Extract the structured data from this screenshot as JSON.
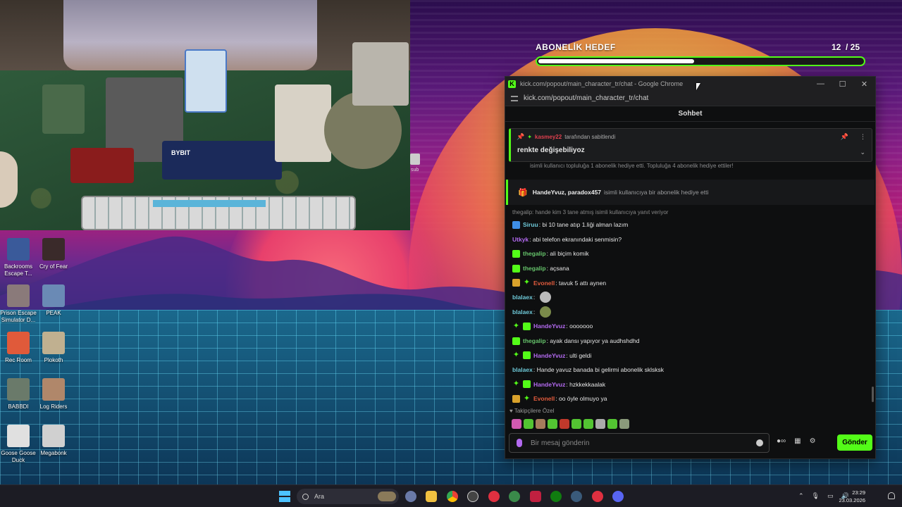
{
  "goal": {
    "title": "ABONELİK HEDEF",
    "current": 12,
    "separator": "/",
    "target": 25,
    "current_text": "12",
    "target_text": "/ 25",
    "progress_fraction": 0.48
  },
  "window": {
    "title": "kick.com/popout/main_character_tr/chat - Google Chrome",
    "url": "kick.com/popout/main_character_tr/chat",
    "minimize": "—",
    "maximize": "☐",
    "close": "✕"
  },
  "chat": {
    "header": "Sohbet",
    "pinned": {
      "by_user": "kasmey22",
      "by_suffix": "tarafından sabitlendi",
      "message": "renkte değişebiliyoz"
    },
    "gift_clip_text": "isimli kullanıcı topluluğa 1 abonelik hediye etti. Topluluğa 4 abonelik hediye ettiler!",
    "gift_card": {
      "names": "HandeYvuz, paradox457",
      "text": "isimli kullanıcıya bir abonelik hediye etti"
    },
    "reply_line": "thegalip: hande kim 3 tane atmış isimli kullanıcıya yanıt veriyor",
    "messages": [
      {
        "user": "Siruu",
        "text": "bi 10 tane atıp 1.liği alman lazım",
        "color": "u-teal",
        "badges": [
          "verified"
        ]
      },
      {
        "user": "Utkyk",
        "text": "abi telefon ekranındaki senmisin?",
        "color": "u-purple",
        "badges": []
      },
      {
        "user": "thegalip",
        "text": "ali biçim komik",
        "color": "u-green",
        "badges": [
          "sub"
        ]
      },
      {
        "user": "thegalip",
        "text": "açsana",
        "color": "u-green",
        "badges": [
          "sub"
        ]
      },
      {
        "user": "Evonell",
        "text": "tavuk 5 attı aynen",
        "color": "u-red",
        "badges": [
          "crown",
          "spark"
        ]
      },
      {
        "user": "blalaex",
        "text": "",
        "color": "u-teal",
        "badges": [],
        "emote": "#bbbbbb"
      },
      {
        "user": "blalaex",
        "text": "",
        "color": "u-teal",
        "badges": [],
        "emote": "#7a8a4a"
      },
      {
        "user": "HandeYvuz",
        "text": "ooooooo",
        "color": "u-purple",
        "badges": [
          "spark",
          "sub"
        ]
      },
      {
        "user": "thegalip",
        "text": "ayak dansı yapıyor ya audhshdhd",
        "color": "u-green",
        "badges": [
          "sub"
        ]
      },
      {
        "user": "HandeYvuz",
        "text": "ulti geldi",
        "color": "u-purple",
        "badges": [
          "spark",
          "sub"
        ]
      },
      {
        "user": "blalaex",
        "text": "Hande yavuz banada bi gelirmi abonelik sklsksk",
        "color": "u-teal",
        "badges": []
      },
      {
        "user": "HandeYvuz",
        "text": "hzkkekkaalak",
        "color": "u-purple",
        "badges": [
          "spark",
          "sub"
        ]
      },
      {
        "user": "Evonell",
        "text": "oo öyle olmuyo ya",
        "color": "u-red",
        "badges": [
          "crown",
          "spark"
        ]
      }
    ],
    "followers_label": "♥ Takipçilere Özel",
    "input_placeholder": "Bir mesaj gönderin",
    "send_label": "Gönder"
  },
  "desktop_icons": [
    {
      "label": "Backrooms Escape T..."
    },
    {
      "label": "Cry of Fear"
    },
    {
      "label": "Prison Escape Simulator D..."
    },
    {
      "label": "PEAK"
    },
    {
      "label": "Rec Room"
    },
    {
      "label": "Plokoth"
    },
    {
      "label": "BABBDI"
    },
    {
      "label": "Log Riders"
    },
    {
      "label": "Goose Goose Duck"
    },
    {
      "label": "Megabonk"
    }
  ],
  "webcam": {
    "keyboard_label": "BYBIT",
    "sub_label": "sub"
  },
  "taskbar": {
    "search_placeholder": "Ara",
    "time": "23:29",
    "date": "23.03.2026"
  },
  "colors": {
    "kick_green": "#53fc18",
    "chat_bg": "#0e0f10"
  }
}
